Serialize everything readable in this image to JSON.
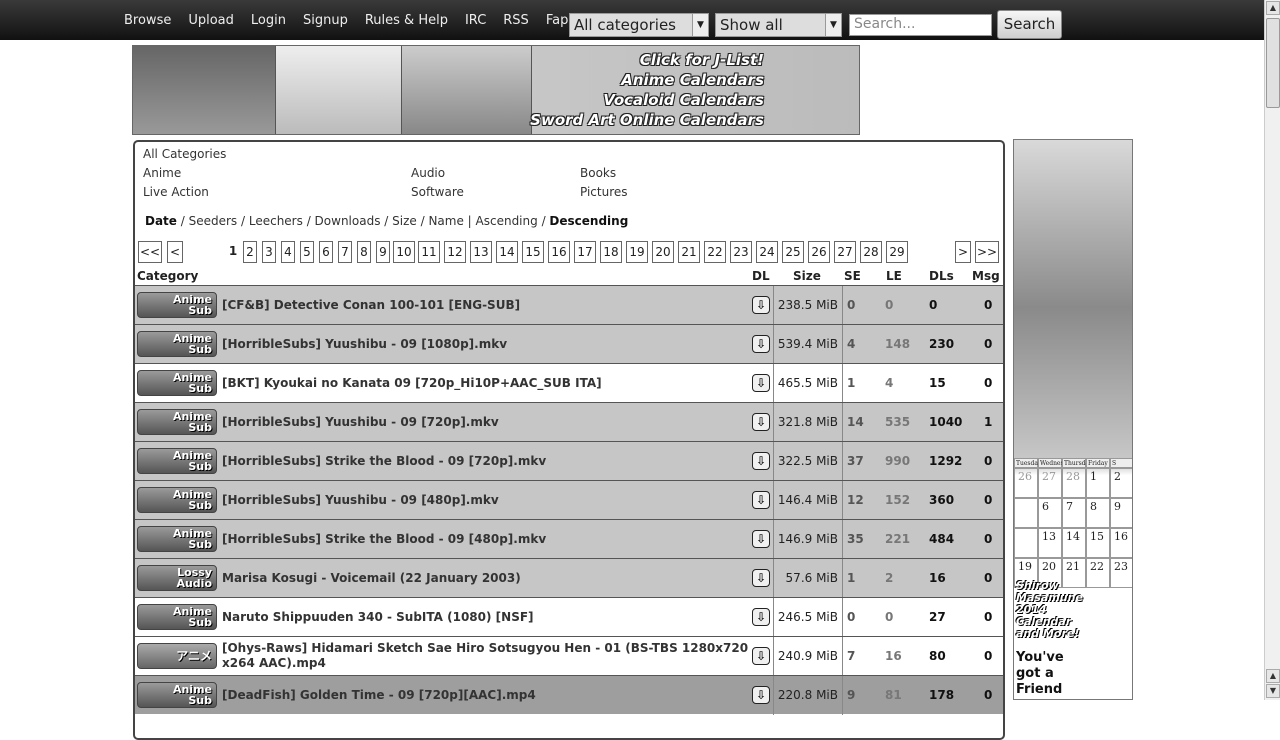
{
  "nav": [
    "Browse",
    "Upload",
    "Login",
    "Signup",
    "Rules & Help",
    "IRC",
    "RSS",
    "Fap"
  ],
  "filters": {
    "category": "All categories",
    "show": "Show all"
  },
  "search": {
    "placeholder": "Search...",
    "button": "Search"
  },
  "banner": {
    "lines": [
      "Click for J-List!",
      "Anime Calendars",
      "Vocaloid Calendars",
      "Sword Art Online Calendars"
    ]
  },
  "side_ad": {
    "calendar_days": [
      "Tuesday",
      "Wednesday",
      "Thursday",
      "Friday",
      "S"
    ],
    "calendar_rows": [
      [
        "",
        "",
        "",
        "1",
        "2"
      ],
      [
        "",
        "6",
        "7",
        "8",
        "9"
      ],
      [
        "",
        "13",
        "14",
        "15",
        "16"
      ],
      [
        "19",
        "20",
        "21",
        "22",
        "23"
      ]
    ],
    "prev_days": [
      "26",
      "27",
      "28"
    ],
    "promo": [
      "Shirow",
      "Masamune",
      "2014",
      "Calendar",
      "and More!"
    ],
    "friend": [
      "You've",
      "got a",
      "Friend"
    ]
  },
  "categories": {
    "all": "All Categories",
    "items": [
      "Anime",
      "Audio",
      "Books",
      "Live Action",
      "Software",
      "Pictures"
    ]
  },
  "sort": {
    "items": [
      "Date",
      "Seeders",
      "Leechers",
      "Downloads",
      "Size",
      "Name"
    ],
    "ascending": "Ascending",
    "descending": "Descending"
  },
  "pager": {
    "first": "<<",
    "prev": "<",
    "next": ">",
    "last": ">>",
    "current": "1",
    "pages": [
      "2",
      "3",
      "4",
      "5",
      "6",
      "7",
      "8",
      "9",
      "10",
      "11",
      "12",
      "13",
      "14",
      "15",
      "16",
      "17",
      "18",
      "19",
      "20",
      "21",
      "22",
      "23",
      "24",
      "25",
      "26",
      "27",
      "28",
      "29"
    ]
  },
  "table_headers": {
    "category": "Category",
    "dl": "DL",
    "size": "Size",
    "se": "SE",
    "le": "LE",
    "dls": "DLs",
    "msg": "Msg"
  },
  "rows": [
    {
      "cat": [
        "Anime",
        "Sub"
      ],
      "name": "[CF&B] Detective Conan 100-101 [ENG-SUB]",
      "size": "238.5 MiB",
      "se": "0",
      "le": "0",
      "dls": "0",
      "msg": "0",
      "style": "grey"
    },
    {
      "cat": [
        "Anime",
        "Sub"
      ],
      "name": "[HorribleSubs] Yuushibu - 09 [1080p].mkv",
      "size": "539.4 MiB",
      "se": "4",
      "le": "148",
      "dls": "230",
      "msg": "0",
      "style": "grey"
    },
    {
      "cat": [
        "Anime",
        "Sub"
      ],
      "name": "[BKT] Kyoukai no Kanata 09 [720p_Hi10P+AAC_SUB ITA]",
      "size": "465.5 MiB",
      "se": "1",
      "le": "4",
      "dls": "15",
      "msg": "0",
      "style": "white"
    },
    {
      "cat": [
        "Anime",
        "Sub"
      ],
      "name": "[HorribleSubs] Yuushibu - 09 [720p].mkv",
      "size": "321.8 MiB",
      "se": "14",
      "le": "535",
      "dls": "1040",
      "msg": "1",
      "style": "grey"
    },
    {
      "cat": [
        "Anime",
        "Sub"
      ],
      "name": "[HorribleSubs] Strike the Blood - 09 [720p].mkv",
      "size": "322.5 MiB",
      "se": "37",
      "le": "990",
      "dls": "1292",
      "msg": "0",
      "style": "grey"
    },
    {
      "cat": [
        "Anime",
        "Sub"
      ],
      "name": "[HorribleSubs] Yuushibu - 09 [480p].mkv",
      "size": "146.4 MiB",
      "se": "12",
      "le": "152",
      "dls": "360",
      "msg": "0",
      "style": "grey"
    },
    {
      "cat": [
        "Anime",
        "Sub"
      ],
      "name": "[HorribleSubs] Strike the Blood - 09 [480p].mkv",
      "size": "146.9 MiB",
      "se": "35",
      "le": "221",
      "dls": "484",
      "msg": "0",
      "style": "grey"
    },
    {
      "cat": [
        "Lossy",
        "Audio"
      ],
      "name": "Marisa Kosugi - Voicemail (22 January 2003)",
      "size": "57.6 MiB",
      "se": "1",
      "le": "2",
      "dls": "16",
      "msg": "0",
      "style": "grey"
    },
    {
      "cat": [
        "Anime",
        "Sub"
      ],
      "name": "Naruto Shippuuden 340 - SubITA (1080) [NSF]",
      "size": "246.5 MiB",
      "se": "0",
      "le": "0",
      "dls": "27",
      "msg": "0",
      "style": "white"
    },
    {
      "cat": [
        "アニメ",
        ""
      ],
      "name": "[Ohys-Raws] Hidamari Sketch Sae Hiro Sotsugyou Hen - 01 (BS-TBS 1280x720 x264 AAC).mp4",
      "size": "240.9 MiB",
      "se": "7",
      "le": "16",
      "dls": "80",
      "msg": "0",
      "style": "white"
    },
    {
      "cat": [
        "Anime",
        "Sub"
      ],
      "name": "[DeadFish] Golden Time - 09 [720p][AAC].mp4",
      "size": "220.8 MiB",
      "se": "9",
      "le": "81",
      "dls": "178",
      "msg": "0",
      "style": "dark"
    }
  ]
}
